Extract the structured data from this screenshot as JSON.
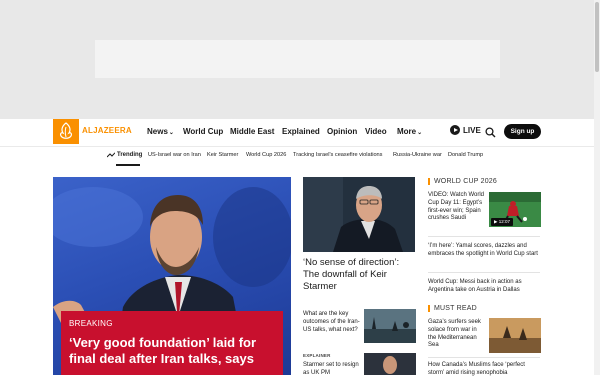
{
  "header": {
    "brand": "ALJAZEERA",
    "nav": [
      {
        "label": "News",
        "dropdown": true
      },
      {
        "label": "World Cup",
        "dropdown": false
      },
      {
        "label": "Middle East",
        "dropdown": false
      },
      {
        "label": "Explained",
        "dropdown": false
      },
      {
        "label": "Opinion",
        "dropdown": false
      },
      {
        "label": "Video",
        "dropdown": false
      },
      {
        "label": "More",
        "dropdown": true
      }
    ],
    "live_label": "LIVE",
    "signup_label": "Sign up"
  },
  "trending": {
    "label": "Trending",
    "items": [
      "US-Israel war on Iran",
      "Keir Starmer",
      "World Cup 2026",
      "Tracking Israel's ceasefire violations",
      "Russia-Ukraine war",
      "Donald Trump"
    ]
  },
  "hero": {
    "badge": "BREAKING",
    "headline": "‘Very good foundation’ laid for final deal after Iran talks, says"
  },
  "middle": {
    "headline": "‘No sense of direction’: The downfall of Keir Starmer",
    "item1": "What are the key outcomes of the Iran-US talks, what next?",
    "explainer_label": "EXPLAINER",
    "item2": "Starmer set to resign as UK PM"
  },
  "right": {
    "world_cup_head": "WORLD CUP 2026",
    "wc_items": [
      "VIDEO: Watch World Cup Day 11: Egypt’s first-ever win; Spain crushes Saudi",
      "‘I’m here’: Yamal scores, dazzles and embraces the spotlight in World Cup start",
      "World Cup: Messi back in action as Argentina take on Austria in Dallas"
    ],
    "video_duration": "12:07",
    "must_read_head": "MUST READ",
    "mr_items": [
      "Gaza’s surfers seek solace from war in the Mediterranean Sea",
      "How Canada’s Muslims face ‘perfect storm’ amid rising xenophobia"
    ]
  },
  "colors": {
    "brand_orange": "#fa9000",
    "breaking_red": "#c8102e",
    "text": "#1a1a1a"
  }
}
